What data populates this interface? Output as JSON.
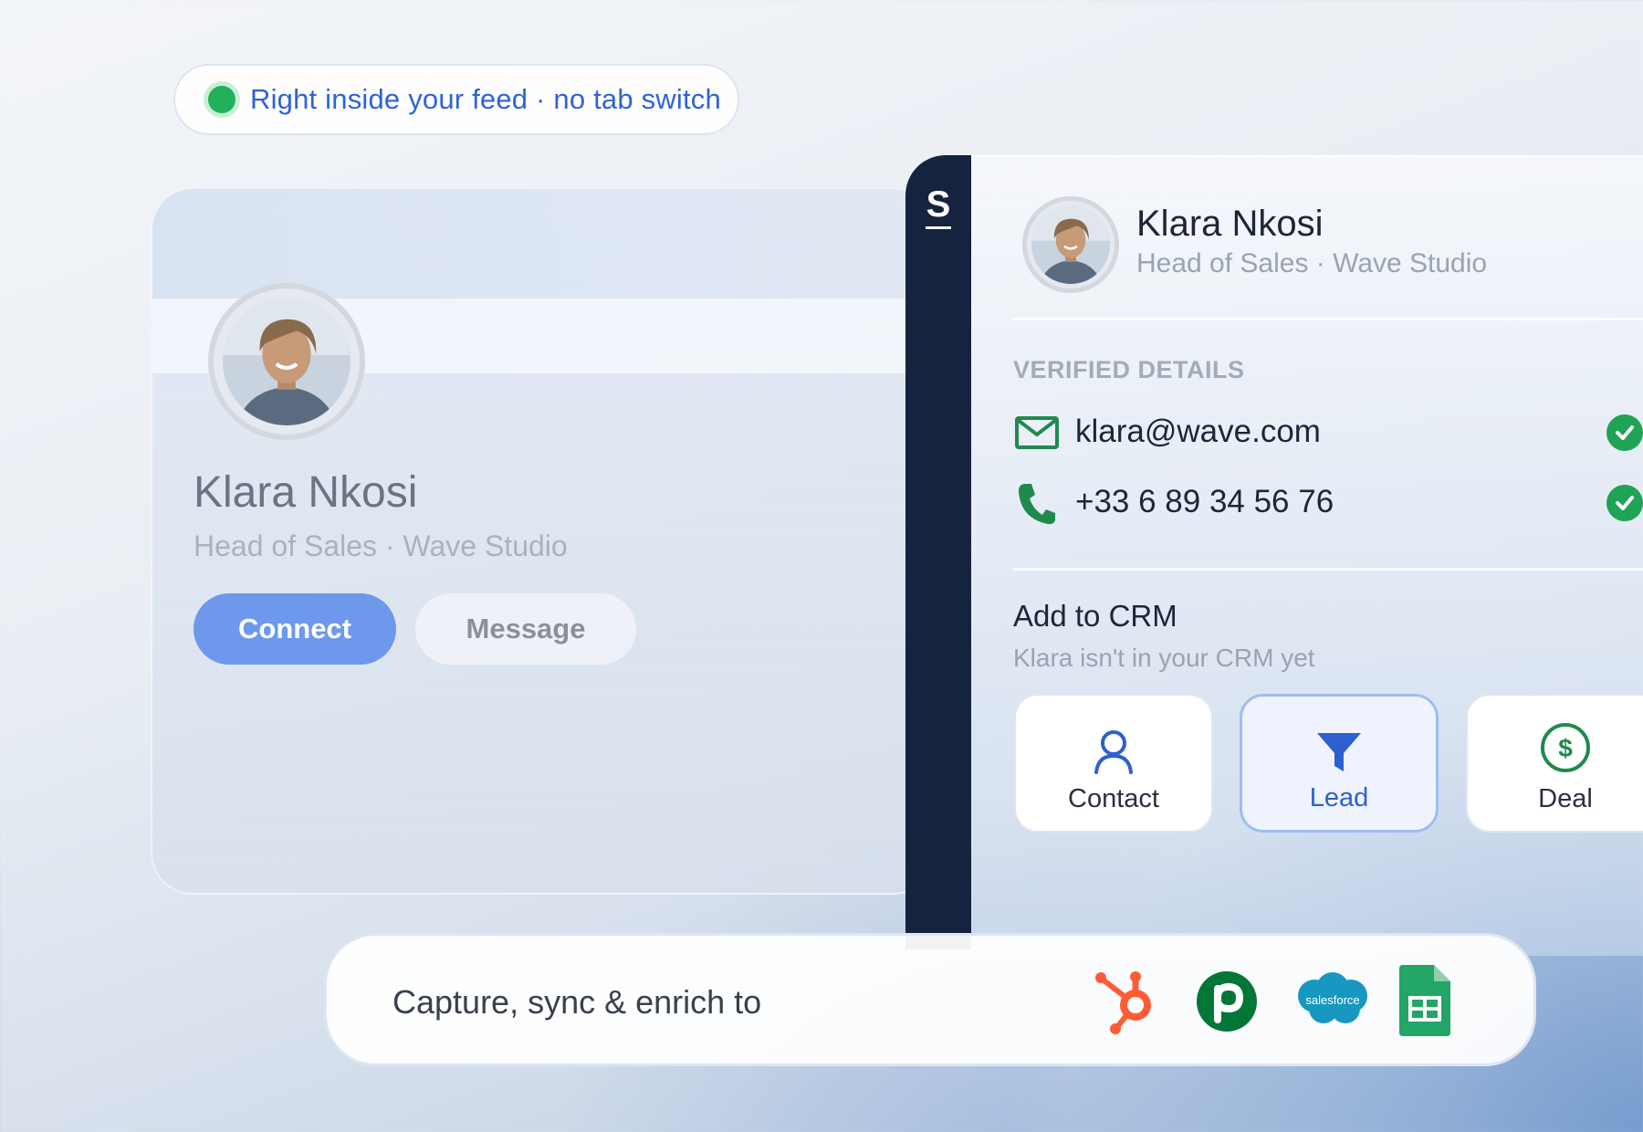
{
  "badge": {
    "text": "Right inside your feed · no tab switch",
    "dot_color": "#22b05a"
  },
  "profile": {
    "name": "Klara Nkosi",
    "subtitle": "Head of Sales · Wave Studio",
    "connect_label": "Connect",
    "message_label": "Message"
  },
  "extension": {
    "logo_letter": "S",
    "name": "Klara Nkosi",
    "subtitle": "Head of Sales · Wave Studio",
    "verified_heading": "VERIFIED DETAILS",
    "details": [
      {
        "icon": "mail-icon",
        "value": "klara@wave.com",
        "verified": true
      },
      {
        "icon": "phone-icon",
        "value": "+33 6 89 34 56 76",
        "verified": true
      }
    ],
    "crm": {
      "title": "Add to CRM",
      "subtitle": "Klara isn't in your CRM yet",
      "options": [
        {
          "icon": "person-icon",
          "label": "Contact",
          "selected": false
        },
        {
          "icon": "funnel-icon",
          "label": "Lead",
          "selected": true
        },
        {
          "icon": "dollar-circle-icon",
          "label": "Deal",
          "selected": false
        }
      ]
    }
  },
  "integrations": {
    "text": "Capture, sync & enrich to",
    "logos": [
      {
        "icon": "hubspot-icon",
        "color": "#ff5c35"
      },
      {
        "icon": "pipedrive-icon",
        "letter": "p",
        "color": "#017737"
      },
      {
        "icon": "salesforce-icon",
        "text": "salesforce",
        "color": "#1798c1"
      },
      {
        "icon": "google-sheets-icon",
        "color": "#23a566"
      }
    ]
  },
  "colors": {
    "accent": "#2f63d6",
    "rail": "#15233f",
    "verified": "#1fa355"
  }
}
